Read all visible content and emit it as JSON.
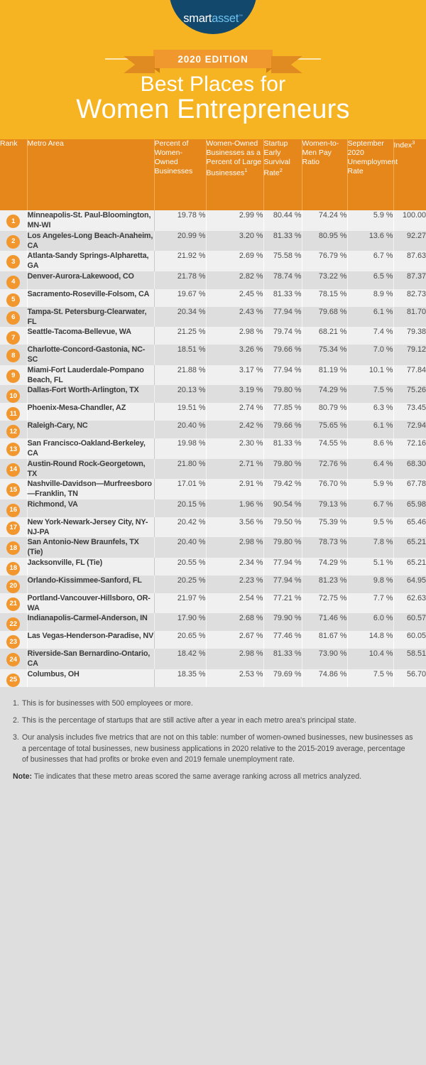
{
  "hero": {
    "logo": {
      "part1": "smart",
      "part2": "asset",
      "tm": "™"
    },
    "ribbon_label": "2020 EDITION",
    "title_line1": "Best Places for",
    "title_line2": "Women Entrepreneurs",
    "bg_color": "#F7B422",
    "accent_color": "#E5871B"
  },
  "table": {
    "columns": [
      "Rank",
      "Metro Area",
      "Percent of Women-Owned Businesses",
      "Women-Owned Businesses as a Percent of Large Businesses",
      "Startup Early Survival Rate",
      "Women-to-Men Pay Ratio",
      "September 2020 Unemployment Rate",
      "Index"
    ],
    "column_sups": [
      "",
      "",
      "",
      "1",
      "2",
      "",
      "",
      "3"
    ],
    "rows": [
      {
        "rank": "1",
        "metro": "Minneapolis-St. Paul-Bloomington, MN-WI",
        "pct_women_owned": "19.78 %",
        "pct_large": "2.99 %",
        "survival": "80.44 %",
        "pay_ratio": "74.24 %",
        "unemployment": "5.9 %",
        "index": "100.00"
      },
      {
        "rank": "2",
        "metro": "Los Angeles-Long Beach-Anaheim, CA",
        "pct_women_owned": "20.99 %",
        "pct_large": "3.20 %",
        "survival": "81.33 %",
        "pay_ratio": "80.95 %",
        "unemployment": "13.6 %",
        "index": "92.27"
      },
      {
        "rank": "3",
        "metro": "Atlanta-Sandy Springs-Alpharetta, GA",
        "pct_women_owned": "21.92 %",
        "pct_large": "2.69 %",
        "survival": "75.58 %",
        "pay_ratio": "76.79 %",
        "unemployment": "6.7 %",
        "index": "87.63"
      },
      {
        "rank": "4",
        "metro": "Denver-Aurora-Lakewood, CO",
        "pct_women_owned": "21.78 %",
        "pct_large": "2.82 %",
        "survival": "78.74 %",
        "pay_ratio": "73.22 %",
        "unemployment": "6.5 %",
        "index": "87.37"
      },
      {
        "rank": "5",
        "metro": "Sacramento-Roseville-Folsom, CA",
        "pct_women_owned": "19.67 %",
        "pct_large": "2.45 %",
        "survival": "81.33 %",
        "pay_ratio": "78.15 %",
        "unemployment": "8.9 %",
        "index": "82.73"
      },
      {
        "rank": "6",
        "metro": "Tampa-St. Petersburg-Clearwater, FL",
        "pct_women_owned": "20.34 %",
        "pct_large": "2.43 %",
        "survival": "77.94 %",
        "pay_ratio": "79.68 %",
        "unemployment": "6.1 %",
        "index": "81.70"
      },
      {
        "rank": "7",
        "metro": "Seattle-Tacoma-Bellevue, WA",
        "pct_women_owned": "21.25 %",
        "pct_large": "2.98 %",
        "survival": "79.74 %",
        "pay_ratio": "68.21 %",
        "unemployment": "7.4 %",
        "index": "79.38"
      },
      {
        "rank": "8",
        "metro": "Charlotte-Concord-Gastonia, NC-SC",
        "pct_women_owned": "18.51 %",
        "pct_large": "3.26 %",
        "survival": "79.66 %",
        "pay_ratio": "75.34 %",
        "unemployment": "7.0 %",
        "index": "79.12"
      },
      {
        "rank": "9",
        "metro": "Miami-Fort Lauderdale-Pompano Beach, FL",
        "pct_women_owned": "21.88 %",
        "pct_large": "3.17 %",
        "survival": "77.94 %",
        "pay_ratio": "81.19 %",
        "unemployment": "10.1 %",
        "index": "77.84"
      },
      {
        "rank": "10",
        "metro": "Dallas-Fort Worth-Arlington, TX",
        "pct_women_owned": "20.13 %",
        "pct_large": "3.19 %",
        "survival": "79.80 %",
        "pay_ratio": "74.29 %",
        "unemployment": "7.5 %",
        "index": "75.26"
      },
      {
        "rank": "11",
        "metro": "Phoenix-Mesa-Chandler, AZ",
        "pct_women_owned": "19.51 %",
        "pct_large": "2.74 %",
        "survival": "77.85 %",
        "pay_ratio": "80.79 %",
        "unemployment": "6.3 %",
        "index": "73.45"
      },
      {
        "rank": "12",
        "metro": "Raleigh-Cary, NC",
        "pct_women_owned": "20.40 %",
        "pct_large": "2.42 %",
        "survival": "79.66 %",
        "pay_ratio": "75.65 %",
        "unemployment": "6.1 %",
        "index": "72.94"
      },
      {
        "rank": "13",
        "metro": "San Francisco-Oakland-Berkeley, CA",
        "pct_women_owned": "19.98 %",
        "pct_large": "2.30 %",
        "survival": "81.33 %",
        "pay_ratio": "74.55 %",
        "unemployment": "8.6 %",
        "index": "72.16"
      },
      {
        "rank": "14",
        "metro": "Austin-Round Rock-Georgetown, TX",
        "pct_women_owned": "21.80 %",
        "pct_large": "2.71 %",
        "survival": "79.80 %",
        "pay_ratio": "72.76 %",
        "unemployment": "6.4 %",
        "index": "68.30"
      },
      {
        "rank": "15",
        "metro": "Nashville-Davidson—Murfreesboro—Franklin, TN",
        "pct_women_owned": "17.01 %",
        "pct_large": "2.91 %",
        "survival": "79.42 %",
        "pay_ratio": "76.70 %",
        "unemployment": "5.9 %",
        "index": "67.78"
      },
      {
        "rank": "16",
        "metro": "Richmond, VA",
        "pct_women_owned": "20.15 %",
        "pct_large": "1.96 %",
        "survival": "90.54 %",
        "pay_ratio": "79.13 %",
        "unemployment": "6.7 %",
        "index": "65.98"
      },
      {
        "rank": "17",
        "metro": "New York-Newark-Jersey City, NY-NJ-PA",
        "pct_women_owned": "20.42 %",
        "pct_large": "3.56 %",
        "survival": "79.50 %",
        "pay_ratio": "75.39 %",
        "unemployment": "9.5 %",
        "index": "65.46"
      },
      {
        "rank": "18",
        "metro": "San Antonio-New Braunfels, TX (Tie)",
        "pct_women_owned": "20.40 %",
        "pct_large": "2.98 %",
        "survival": "79.80 %",
        "pay_ratio": "78.73 %",
        "unemployment": "7.8 %",
        "index": "65.21"
      },
      {
        "rank": "18",
        "metro": "Jacksonville, FL (Tie)",
        "pct_women_owned": "20.55 %",
        "pct_large": "2.34 %",
        "survival": "77.94 %",
        "pay_ratio": "74.29 %",
        "unemployment": "5.1 %",
        "index": "65.21"
      },
      {
        "rank": "20",
        "metro": "Orlando-Kissimmee-Sanford, FL",
        "pct_women_owned": "20.25 %",
        "pct_large": "2.23 %",
        "survival": "77.94 %",
        "pay_ratio": "81.23 %",
        "unemployment": "9.8 %",
        "index": "64.95"
      },
      {
        "rank": "21",
        "metro": "Portland-Vancouver-Hillsboro, OR-WA",
        "pct_women_owned": "21.97 %",
        "pct_large": "2.54 %",
        "survival": "77.21 %",
        "pay_ratio": "72.75 %",
        "unemployment": "7.7 %",
        "index": "62.63"
      },
      {
        "rank": "22",
        "metro": "Indianapolis-Carmel-Anderson, IN",
        "pct_women_owned": "17.90 %",
        "pct_large": "2.68 %",
        "survival": "79.90 %",
        "pay_ratio": "71.46 %",
        "unemployment": "6.0 %",
        "index": "60.57"
      },
      {
        "rank": "23",
        "metro": "Las Vegas-Henderson-Paradise, NV",
        "pct_women_owned": "20.65 %",
        "pct_large": "2.67 %",
        "survival": "77.46 %",
        "pay_ratio": "81.67 %",
        "unemployment": "14.8 %",
        "index": "60.05"
      },
      {
        "rank": "24",
        "metro": "Riverside-San Bernardino-Ontario, CA",
        "pct_women_owned": "18.42 %",
        "pct_large": "2.98 %",
        "survival": "81.33 %",
        "pay_ratio": "73.90 %",
        "unemployment": "10.4 %",
        "index": "58.51"
      },
      {
        "rank": "25",
        "metro": "Columbus, OH",
        "pct_women_owned": "18.35 %",
        "pct_large": "2.53 %",
        "survival": "79.69 %",
        "pay_ratio": "74.86 %",
        "unemployment": "7.5 %",
        "index": "56.70"
      }
    ]
  },
  "footnotes": [
    {
      "marker": "1.",
      "text": "This is for businesses with 500 employees or more."
    },
    {
      "marker": "2.",
      "text": "This is the percentage of startups that are still active after a year in each metro area's principal state."
    },
    {
      "marker": "3.",
      "text": "Our analysis includes five metrics that are not on this table: number of women-owned businesses, new businesses as a percentage of total businesses, new business applications in 2020 relative to the 2015-2019 average, percentage of businesses that had profits or broke even and 2019 female unemployment rate."
    }
  ],
  "note": {
    "label": "Note:",
    "text": " Tie indicates that these metro areas scored the same average ranking across all metrics analyzed."
  }
}
